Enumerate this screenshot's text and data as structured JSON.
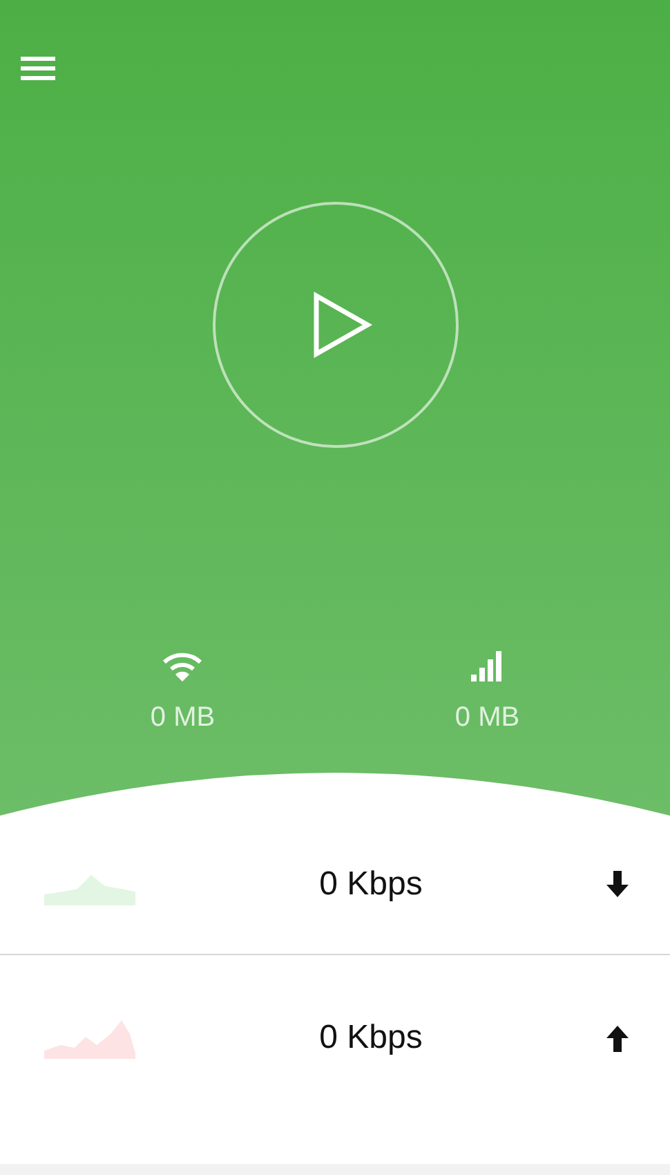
{
  "stats": [
    {
      "kind": "wifi",
      "value": "0 MB"
    },
    {
      "kind": "cellular",
      "value": "0 MB"
    }
  ],
  "speeds": [
    {
      "kind": "download",
      "reading": "0 Kbps"
    },
    {
      "kind": "upload",
      "reading": "0 Kbps"
    }
  ]
}
